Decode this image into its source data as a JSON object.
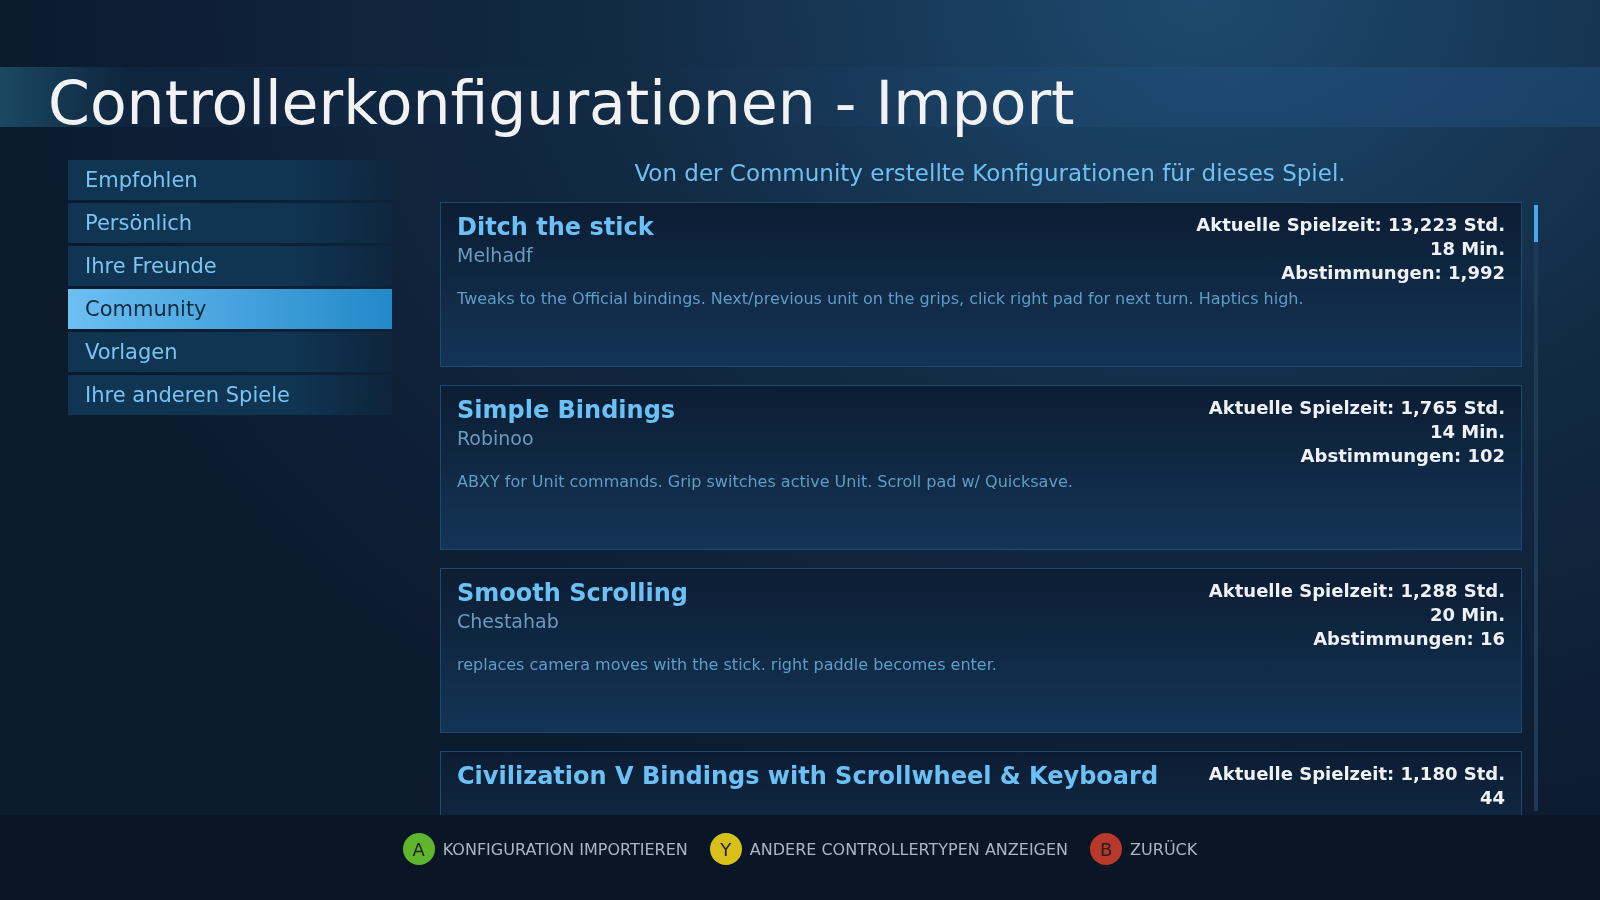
{
  "title": "Controllerkonfigurationen - Import",
  "sidebar": {
    "items": [
      {
        "label": "Empfohlen",
        "selected": false
      },
      {
        "label": "Persönlich",
        "selected": false
      },
      {
        "label": "Ihre Freunde",
        "selected": false
      },
      {
        "label": "Community",
        "selected": true
      },
      {
        "label": "Vorlagen",
        "selected": false
      },
      {
        "label": "Ihre anderen Spiele",
        "selected": false
      }
    ]
  },
  "subtitle": "Von der Community erstellte Konfigurationen für dieses Spiel.",
  "configs": [
    {
      "name": "Ditch the stick",
      "author": "Melhadf",
      "description": "Tweaks to the Official bindings.  Next/previous unit on the grips, click right pad for next turn.  Haptics high.",
      "playtime": "Aktuelle Spielzeit: 13,223 Std. 18 Min.",
      "votes": "Abstimmungen: 1,992"
    },
    {
      "name": "Simple Bindings",
      "author": "Robinoo",
      "description": "ABXY for Unit commands. Grip switches active Unit. Scroll pad w/ Quicksave.",
      "playtime": "Aktuelle Spielzeit: 1,765 Std. 14 Min.",
      "votes": "Abstimmungen: 102"
    },
    {
      "name": "Smooth Scrolling",
      "author": "Chestahab",
      "description": "replaces camera moves with the stick. right  paddle  becomes enter.",
      "playtime": "Aktuelle Spielzeit: 1,288 Std. 20 Min.",
      "votes": "Abstimmungen: 16"
    },
    {
      "name": "Civilization V Bindings with Scrollwheel & Keyboard",
      "playtime": "Aktuelle Spielzeit: 1,180 Std. 44"
    }
  ],
  "footer": [
    {
      "key": "A",
      "label": "KONFIGURATION IMPORTIEREN",
      "color": "#5fb52c"
    },
    {
      "key": "Y",
      "label": "ANDERE CONTROLLERTYPEN ANZEIGEN",
      "color": "#d8c01a"
    },
    {
      "key": "B",
      "label": "ZURÜCK",
      "color": "#b8392b"
    }
  ]
}
